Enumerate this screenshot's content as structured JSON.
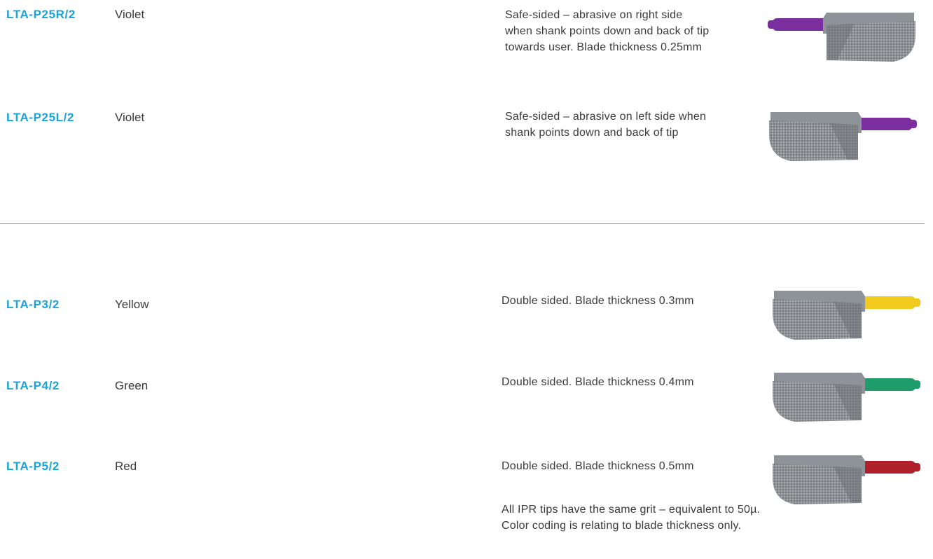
{
  "products": [
    {
      "code": "LTA-P25R/2",
      "color_name": "Violet",
      "desc_lines": [
        "Safe-sided – abrasive on right side",
        "when shank points down and back of tip",
        "towards user. Blade thickness 0.25mm"
      ],
      "shank_color": "#7b2f9e",
      "orientation": "right"
    },
    {
      "code": "LTA-P25L/2",
      "color_name": "Violet",
      "desc_lines": [
        "Safe-sided – abrasive on left side when",
        "shank points down and back of tip"
      ],
      "shank_color": "#7b2f9e",
      "orientation": "left"
    },
    {
      "code": "LTA-P3/2",
      "color_name": "Yellow",
      "desc_lines": [
        "Double sided. Blade thickness 0.3mm"
      ],
      "shank_color": "#f2c91d",
      "orientation": "left"
    },
    {
      "code": "LTA-P4/2",
      "color_name": "Green",
      "desc_lines": [
        "Double sided. Blade thickness 0.4mm"
      ],
      "shank_color": "#1e9c6a",
      "orientation": "left"
    },
    {
      "code": "LTA-P5/2",
      "color_name": "Red",
      "desc_lines": [
        "Double sided. Blade thickness 0.5mm"
      ],
      "shank_color": "#b0202a",
      "orientation": "left"
    }
  ],
  "note": {
    "line1": "All IPR tips have the same grit – equivalent to 50µ.",
    "line2": "Color coding is relating to blade thickness only."
  }
}
